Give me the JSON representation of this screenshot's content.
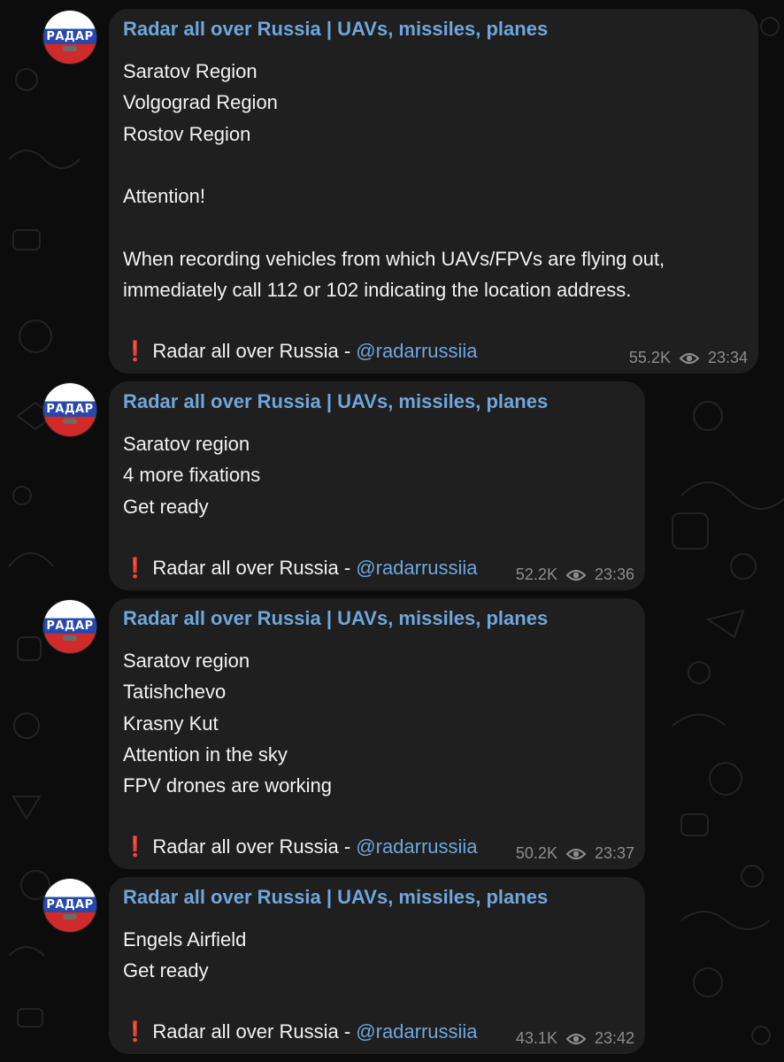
{
  "messages": [
    {
      "sender": "Radar all over Russia | UAVs, missiles, planes",
      "avatar_text": "РАДАР",
      "lines": [
        "Saratov Region",
        "Volgograd Region",
        "Rostov Region",
        "",
        "Attention!",
        "",
        "When recording vehicles from which UAVs/FPVs are flying out,",
        "immediately call 112 or 102 indicating the location address.",
        ""
      ],
      "signature": {
        "mark": "❗",
        "text": "Radar all over Russia - ",
        "handle": "@radarrussiia"
      },
      "views": "55.2K",
      "time": "23:34"
    },
    {
      "sender": "Radar all over Russia | UAVs, missiles, planes",
      "avatar_text": "РАДАР",
      "lines": [
        "Saratov region",
        "4 more fixations",
        "Get ready",
        ""
      ],
      "signature": {
        "mark": "❗",
        "text": "Radar all over Russia - ",
        "handle": "@radarrussiia"
      },
      "views": "52.2K",
      "time": "23:36"
    },
    {
      "sender": "Radar all over Russia | UAVs, missiles, planes",
      "avatar_text": "РАДАР",
      "lines": [
        "Saratov region",
        "Tatishchevo",
        "Krasny Kut",
        "Attention in the sky",
        "FPV drones are working",
        ""
      ],
      "signature": {
        "mark": "❗",
        "text": "Radar all over Russia - ",
        "handle": "@radarrussiia"
      },
      "views": "50.2K",
      "time": "23:37"
    },
    {
      "sender": "Radar all over Russia | UAVs, missiles, planes",
      "avatar_text": "РАДАР",
      "lines": [
        "Engels Airfield",
        "Get ready",
        ""
      ],
      "signature": {
        "mark": "❗",
        "text": "Radar all over Russia - ",
        "handle": "@radarrussiia"
      },
      "views": "43.1K",
      "time": "23:42"
    }
  ],
  "colors": {
    "background": "#0c0c0c",
    "bubble": "#1f1f1f",
    "sender": "#6fa6dc",
    "text": "#f2f2f2",
    "meta": "#8c8c8c",
    "mark": "#e0302a"
  },
  "icons": {
    "views": "eye-icon",
    "pattern": "doodle-pattern"
  }
}
